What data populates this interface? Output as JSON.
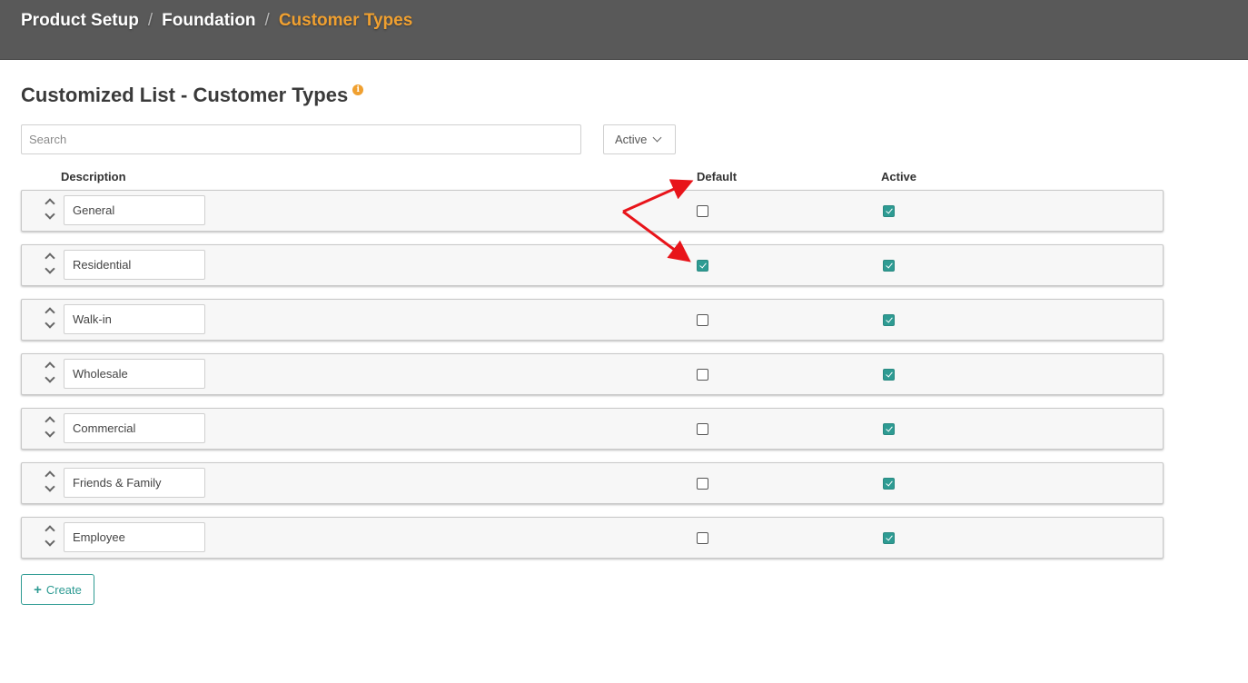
{
  "breadcrumb": {
    "items": [
      "Product Setup",
      "Foundation"
    ],
    "current": "Customer Types",
    "separator": "/"
  },
  "page": {
    "title": "Customized List - Customer Types",
    "info_icon": "info-icon"
  },
  "search": {
    "placeholder": "Search",
    "value": ""
  },
  "filter": {
    "value": "Active"
  },
  "columns": {
    "description": "Description",
    "default": "Default",
    "active": "Active"
  },
  "rows": [
    {
      "description": "General",
      "default": false,
      "active": true
    },
    {
      "description": "Residential",
      "default": true,
      "active": true
    },
    {
      "description": "Walk-in",
      "default": false,
      "active": true
    },
    {
      "description": "Wholesale",
      "default": false,
      "active": true
    },
    {
      "description": "Commercial",
      "default": false,
      "active": true
    },
    {
      "description": "Friends & Family",
      "default": false,
      "active": true
    },
    {
      "description": "Employee",
      "default": false,
      "active": true
    }
  ],
  "create_button": {
    "label": "Create",
    "icon": "plus-icon"
  },
  "colors": {
    "accent": "#2e9b93",
    "breadcrumb_current": "#f0a030",
    "topbar": "#595959",
    "annotation": "#e8141a"
  }
}
